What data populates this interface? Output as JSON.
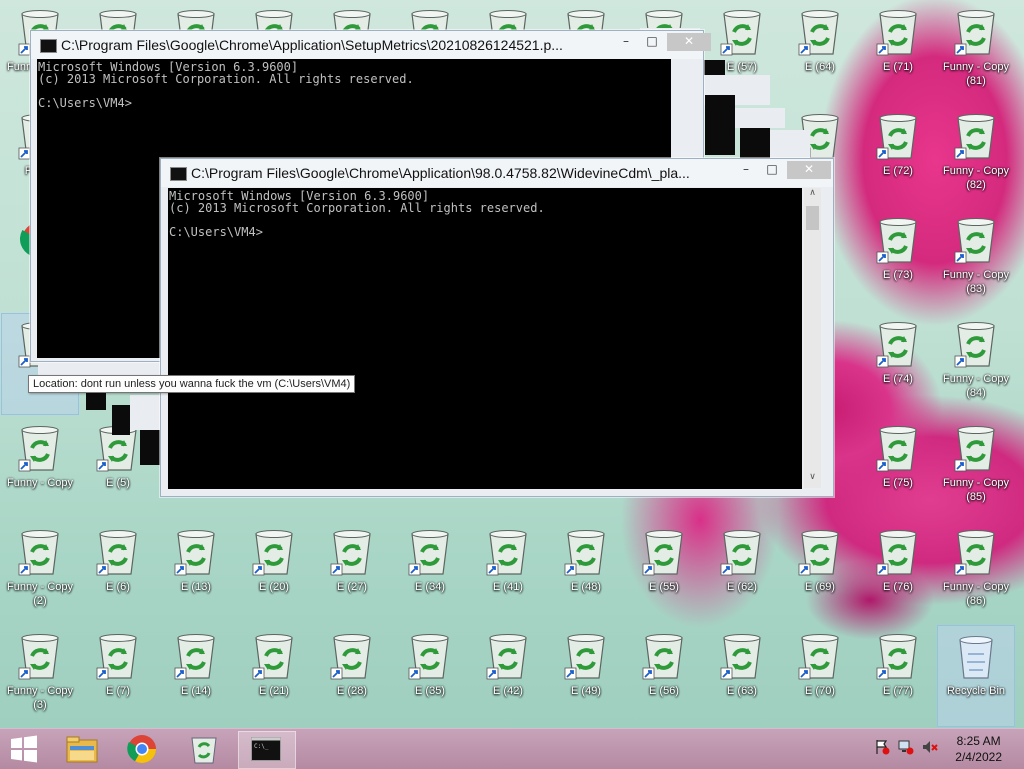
{
  "desktop": {
    "icons": [
      {
        "label": "Funny - Copy",
        "col": 0,
        "row": 0
      },
      {
        "label": "",
        "col": 1,
        "row": 0
      },
      {
        "label": "",
        "col": 2,
        "row": 0
      },
      {
        "label": "",
        "col": 3,
        "row": 0
      },
      {
        "label": "",
        "col": 4,
        "row": 0
      },
      {
        "label": "",
        "col": 5,
        "row": 0
      },
      {
        "label": "",
        "col": 6,
        "row": 0
      },
      {
        "label": "",
        "col": 7,
        "row": 0
      },
      {
        "label": "",
        "col": 8,
        "row": 0
      },
      {
        "label": "E (57)",
        "col": 9,
        "row": 0
      },
      {
        "label": "E (64)",
        "col": 10,
        "row": 0
      },
      {
        "label": "E (71)",
        "col": 11,
        "row": 0
      },
      {
        "label": "Funny - Copy (81)",
        "col": 12,
        "row": 0
      },
      {
        "label": "Funny",
        "col": 0,
        "row": 1
      },
      {
        "label": "",
        "col": 10,
        "row": 1
      },
      {
        "label": "E (72)",
        "col": 11,
        "row": 1
      },
      {
        "label": "Funny - Copy (82)",
        "col": 12,
        "row": 1
      },
      {
        "label": "",
        "col": 0,
        "row": 2,
        "chrome": true
      },
      {
        "label": "E (73)",
        "col": 11,
        "row": 2
      },
      {
        "label": "Funny - Copy (83)",
        "col": 12,
        "row": 2
      },
      {
        "label": "",
        "col": 0,
        "row": 3,
        "selected": true
      },
      {
        "label": "E (74)",
        "col": 11,
        "row": 3
      },
      {
        "label": "Funny - Copy (84)",
        "col": 12,
        "row": 3
      },
      {
        "label": "Funny - Copy",
        "col": 0,
        "row": 4
      },
      {
        "label": "E (5)",
        "col": 1,
        "row": 4
      },
      {
        "label": "E (75)",
        "col": 11,
        "row": 4
      },
      {
        "label": "Funny - Copy (85)",
        "col": 12,
        "row": 4
      },
      {
        "label": "Funny - Copy (2)",
        "col": 0,
        "row": 5
      },
      {
        "label": "E (6)",
        "col": 1,
        "row": 5
      },
      {
        "label": "E (13)",
        "col": 2,
        "row": 5
      },
      {
        "label": "E (20)",
        "col": 3,
        "row": 5
      },
      {
        "label": "E (27)",
        "col": 4,
        "row": 5
      },
      {
        "label": "E (34)",
        "col": 5,
        "row": 5
      },
      {
        "label": "E (41)",
        "col": 6,
        "row": 5
      },
      {
        "label": "E (48)",
        "col": 7,
        "row": 5
      },
      {
        "label": "E (55)",
        "col": 8,
        "row": 5
      },
      {
        "label": "E (62)",
        "col": 9,
        "row": 5
      },
      {
        "label": "E (69)",
        "col": 10,
        "row": 5
      },
      {
        "label": "E (76)",
        "col": 11,
        "row": 5
      },
      {
        "label": "Funny - Copy (86)",
        "col": 12,
        "row": 5
      },
      {
        "label": "Funny - Copy (3)",
        "col": 0,
        "row": 6
      },
      {
        "label": "E (7)",
        "col": 1,
        "row": 6
      },
      {
        "label": "E (14)",
        "col": 2,
        "row": 6
      },
      {
        "label": "E (21)",
        "col": 3,
        "row": 6
      },
      {
        "label": "E (28)",
        "col": 4,
        "row": 6
      },
      {
        "label": "E (35)",
        "col": 5,
        "row": 6
      },
      {
        "label": "E (42)",
        "col": 6,
        "row": 6
      },
      {
        "label": "E (49)",
        "col": 7,
        "row": 6
      },
      {
        "label": "E (56)",
        "col": 8,
        "row": 6
      },
      {
        "label": "E (63)",
        "col": 9,
        "row": 6
      },
      {
        "label": "E (70)",
        "col": 10,
        "row": 6
      },
      {
        "label": "E (77)",
        "col": 11,
        "row": 6
      },
      {
        "label": "Recycle Bin",
        "col": 12,
        "row": 6,
        "recycle": true,
        "selected": true
      }
    ]
  },
  "windows": {
    "back": {
      "title": "C:\\Program Files\\Google\\Chrome\\Application\\SetupMetrics\\20210826124521.p...",
      "console": "Microsoft Windows [Version 6.3.9600]\n(c) 2013 Microsoft Corporation. All rights reserved.\n\nC:\\Users\\VM4>",
      "minimize": "–",
      "maximize": "□",
      "close": "✕"
    },
    "front": {
      "title": "C:\\Program Files\\Google\\Chrome\\Application\\98.0.4758.82\\WidevineCdm\\_pla...",
      "console": "Microsoft Windows [Version 6.3.9600]\n(c) 2013 Microsoft Corporation. All rights reserved.\n\nC:\\Users\\VM4>",
      "minimize": "–",
      "maximize": "□",
      "close": "✕",
      "scroll_up": "∧",
      "scroll_down": "∨"
    }
  },
  "tooltip": "Location: dont run unless you wanna fuck the vm (C:\\Users\\VM4)",
  "taskbar": {
    "start_icon": "windows-logo-icon",
    "buttons": [
      "file-explorer-icon",
      "chrome-icon",
      "recycle-bin-icon",
      "command-prompt-icon"
    ],
    "tray": [
      "action-center-flag-icon",
      "network-icon",
      "volume-muted-icon"
    ],
    "time": "8:25 AM",
    "date": "2/4/2022"
  }
}
